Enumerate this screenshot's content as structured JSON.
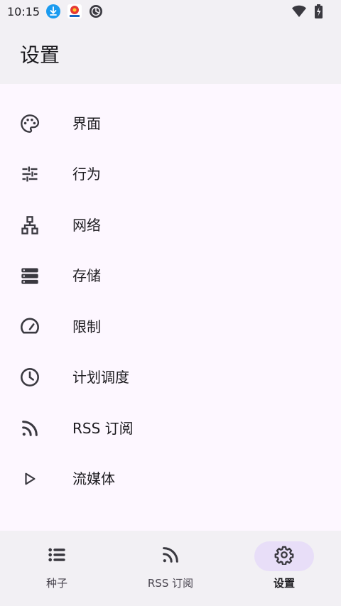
{
  "status_bar": {
    "time": "10:15",
    "icons": [
      "download-icon",
      "app-notification-icon",
      "sync-icon",
      "wifi-icon",
      "battery-charging-icon"
    ]
  },
  "app_bar": {
    "title": "设置"
  },
  "settings": {
    "items": [
      {
        "label": "界面",
        "icon": "palette-icon"
      },
      {
        "label": "行为",
        "icon": "sliders-icon"
      },
      {
        "label": "网络",
        "icon": "network-icon"
      },
      {
        "label": "存储",
        "icon": "storage-icon"
      },
      {
        "label": "限制",
        "icon": "speedometer-icon"
      },
      {
        "label": "计划调度",
        "icon": "clock-icon"
      },
      {
        "label": "RSS 订阅",
        "icon": "rss-icon"
      },
      {
        "label": "流媒体",
        "icon": "play-icon"
      }
    ]
  },
  "bottom_nav": {
    "items": [
      {
        "label": "种子",
        "icon": "list-icon",
        "active": false
      },
      {
        "label": "RSS 订阅",
        "icon": "rss-icon",
        "active": false
      },
      {
        "label": "设置",
        "icon": "gear-icon",
        "active": true
      }
    ]
  },
  "colors": {
    "background": "#fdf7ff",
    "surface": "#f2f0f4",
    "active_indicator": "#e8def8",
    "icon": "#3a3940"
  }
}
